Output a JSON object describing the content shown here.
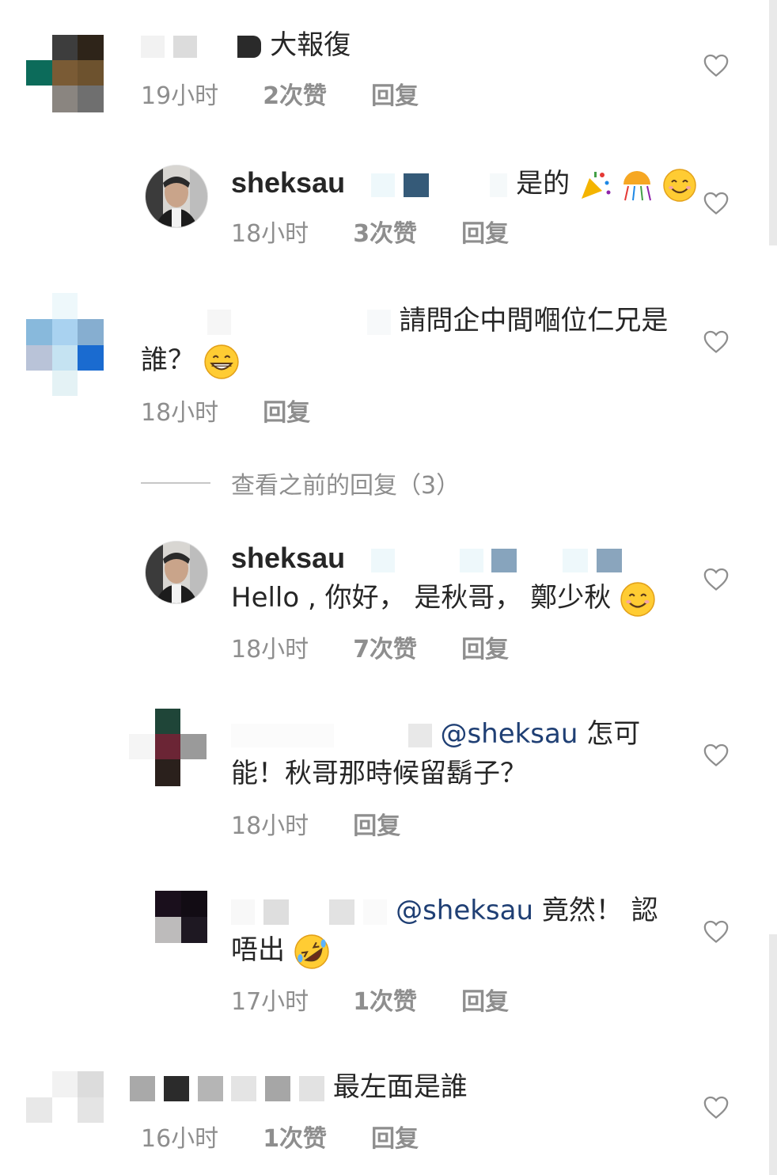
{
  "comments": [
    {
      "username": "",
      "text": "大報復",
      "time": "19小时",
      "likes": "2次赞",
      "reply": "回复"
    },
    {
      "username": "sheksau",
      "text": "是的",
      "time": "18小时",
      "likes": "3次赞",
      "reply": "回复",
      "emojis": [
        "party-popper",
        "confetti-ball",
        "smiling-face"
      ]
    },
    {
      "username": "",
      "text_line1": "請問企中間嗰位仁兄是",
      "text_line2": "誰？",
      "time": "18小时",
      "reply": "回复",
      "emojis": [
        "grinning-face"
      ]
    },
    {
      "username": "sheksau",
      "text": "Hello , 你好， 是秋哥， 鄭少秋",
      "time": "18小时",
      "likes": "7次赞",
      "reply": "回复",
      "emojis": [
        "smiling-face"
      ]
    },
    {
      "username": "",
      "mention": "@sheksau",
      "text_line1": "怎可",
      "text_line2": "能！秋哥那時候留鬍子？",
      "time": "18小时",
      "reply": "回复"
    },
    {
      "username": "",
      "mention": "@sheksau",
      "text_line1": "竟然！ 認",
      "text_line2": "唔出",
      "time": "17小时",
      "likes": "1次赞",
      "reply": "回复",
      "emojis": [
        "rolling-on-floor-laughing"
      ]
    },
    {
      "username": "",
      "text": "最左面是誰",
      "time": "16小时",
      "likes": "1次赞",
      "reply": "回复"
    }
  ],
  "view_previous_replies": "查看之前的回复（3）",
  "colors": {
    "text": "#262626",
    "meta": "#8e8e8e",
    "mention": "#1f3f74"
  }
}
